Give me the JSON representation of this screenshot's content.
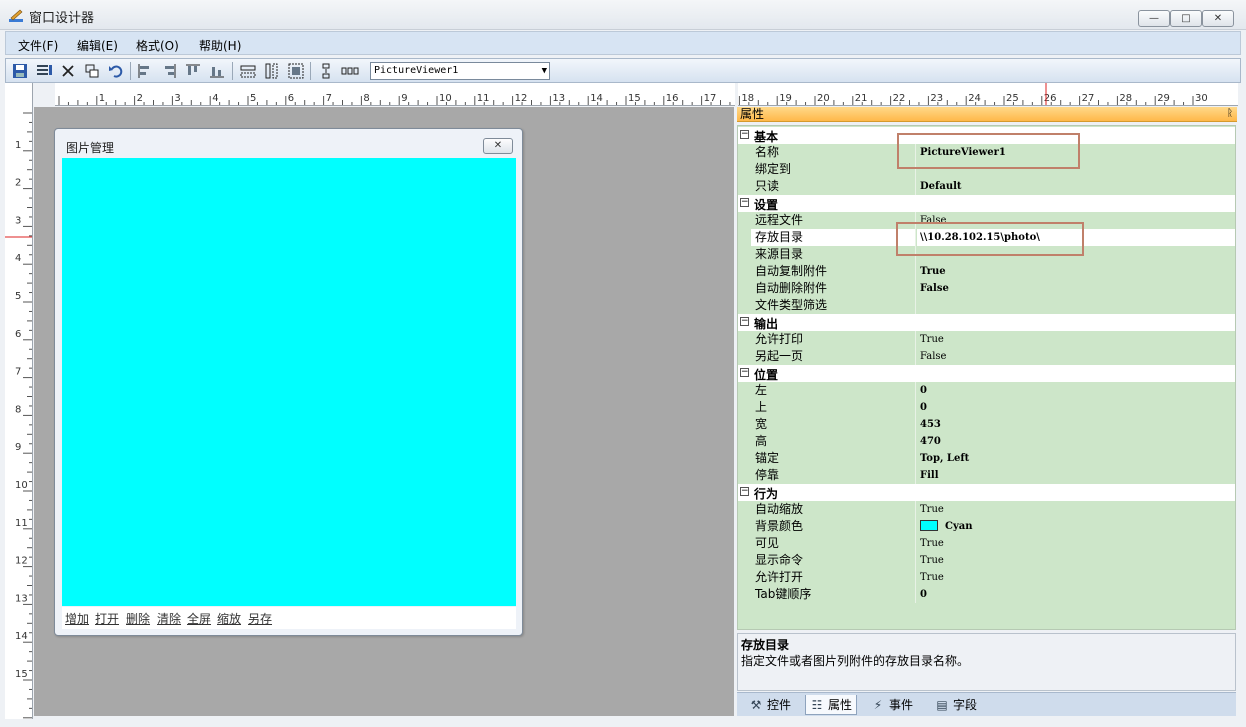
{
  "window": {
    "title": "窗口设计器",
    "min": "—",
    "max": "□",
    "close": "✕"
  },
  "menu": [
    {
      "label": "文件(F)"
    },
    {
      "label": "编辑(E)"
    },
    {
      "label": "格式(O)"
    },
    {
      "label": "帮助(H)"
    }
  ],
  "toolbar": {
    "icons": [
      "save-icon",
      "save-all-icon",
      "delete-icon",
      "copy-icon",
      "undo-icon",
      "align-left-icon",
      "align-right-icon",
      "align-top-icon",
      "align-bottom-icon",
      "same-width-icon",
      "same-height-icon",
      "same-size-icon",
      "vertical-spacing-icon",
      "horizontal-spacing-icon"
    ],
    "component_select": "PictureViewer1"
  },
  "ruler": {
    "top": [
      "1",
      "2",
      "3",
      "4",
      "5",
      "6",
      "7",
      "8",
      "9",
      "10",
      "11",
      "12",
      "13",
      "14",
      "15",
      "16",
      "17",
      "18",
      "19",
      "20",
      "21",
      "22",
      "23",
      "24",
      "25",
      "26",
      "27",
      "28",
      "29",
      "30"
    ],
    "left": [
      "1",
      "2",
      "3",
      "4",
      "5",
      "6",
      "7",
      "8",
      "9",
      "10",
      "11",
      "12",
      "13",
      "14",
      "15",
      "16"
    ]
  },
  "form": {
    "title": "图片管理",
    "close": "✕",
    "background": "#00ffff",
    "links": [
      "增加",
      "打开",
      "删除",
      "清除",
      "全屏",
      "缩放",
      "另存"
    ]
  },
  "properties": {
    "header": "属性",
    "pin": "ᚱ",
    "toggle": "−",
    "categories": [
      {
        "name": "基本",
        "items": [
          {
            "name": "名称",
            "value": "PictureViewer1",
            "bold": true
          },
          {
            "name": "绑定到",
            "value": ""
          },
          {
            "name": "只读",
            "value": "Default",
            "bold": true
          }
        ]
      },
      {
        "name": "设置",
        "items": [
          {
            "name": "远程文件",
            "value": "False"
          },
          {
            "name": "存放目录",
            "value": "\\\\10.28.102.15\\photo\\",
            "bold": true,
            "selected": true
          },
          {
            "name": "来源目录",
            "value": ""
          },
          {
            "name": "自动复制附件",
            "value": "True",
            "bold": true
          },
          {
            "name": "自动删除附件",
            "value": "False",
            "bold": true
          },
          {
            "name": "文件类型筛选",
            "value": ""
          }
        ]
      },
      {
        "name": "输出",
        "items": [
          {
            "name": "允许打印",
            "value": "True"
          },
          {
            "name": "另起一页",
            "value": "False"
          }
        ]
      },
      {
        "name": "位置",
        "items": [
          {
            "name": "左",
            "value": "0",
            "bold": true
          },
          {
            "name": "上",
            "value": "0",
            "bold": true
          },
          {
            "name": "宽",
            "value": "453",
            "bold": true
          },
          {
            "name": "高",
            "value": "470",
            "bold": true
          },
          {
            "name": "锚定",
            "value": "Top, Left",
            "bold": true
          },
          {
            "name": "停靠",
            "value": "Fill",
            "bold": true
          }
        ]
      },
      {
        "name": "行为",
        "items": [
          {
            "name": "自动缩放",
            "value": "True"
          },
          {
            "name": "背景颜色",
            "value": "Cyan",
            "bold": true,
            "swatch": "#00ffff"
          },
          {
            "name": "可见",
            "value": "True"
          },
          {
            "name": "显示命令",
            "value": "True"
          },
          {
            "name": "允许打开",
            "value": "True"
          },
          {
            "name": "Tab键顺序",
            "value": "0",
            "bold": true
          }
        ]
      }
    ],
    "description": {
      "title": "存放目录",
      "text": "指定文件或者图片列附件的存放目录名称。"
    }
  },
  "bottom_tabs": [
    {
      "label": "控件",
      "icon": "tools-icon",
      "glyph": "⚒",
      "active": false
    },
    {
      "label": "属性",
      "icon": "properties-icon",
      "glyph": "☷",
      "active": true
    },
    {
      "label": "事件",
      "icon": "lightning-icon",
      "glyph": "⚡",
      "active": false
    },
    {
      "label": "字段",
      "icon": "field-icon",
      "glyph": "▤",
      "active": false
    }
  ]
}
